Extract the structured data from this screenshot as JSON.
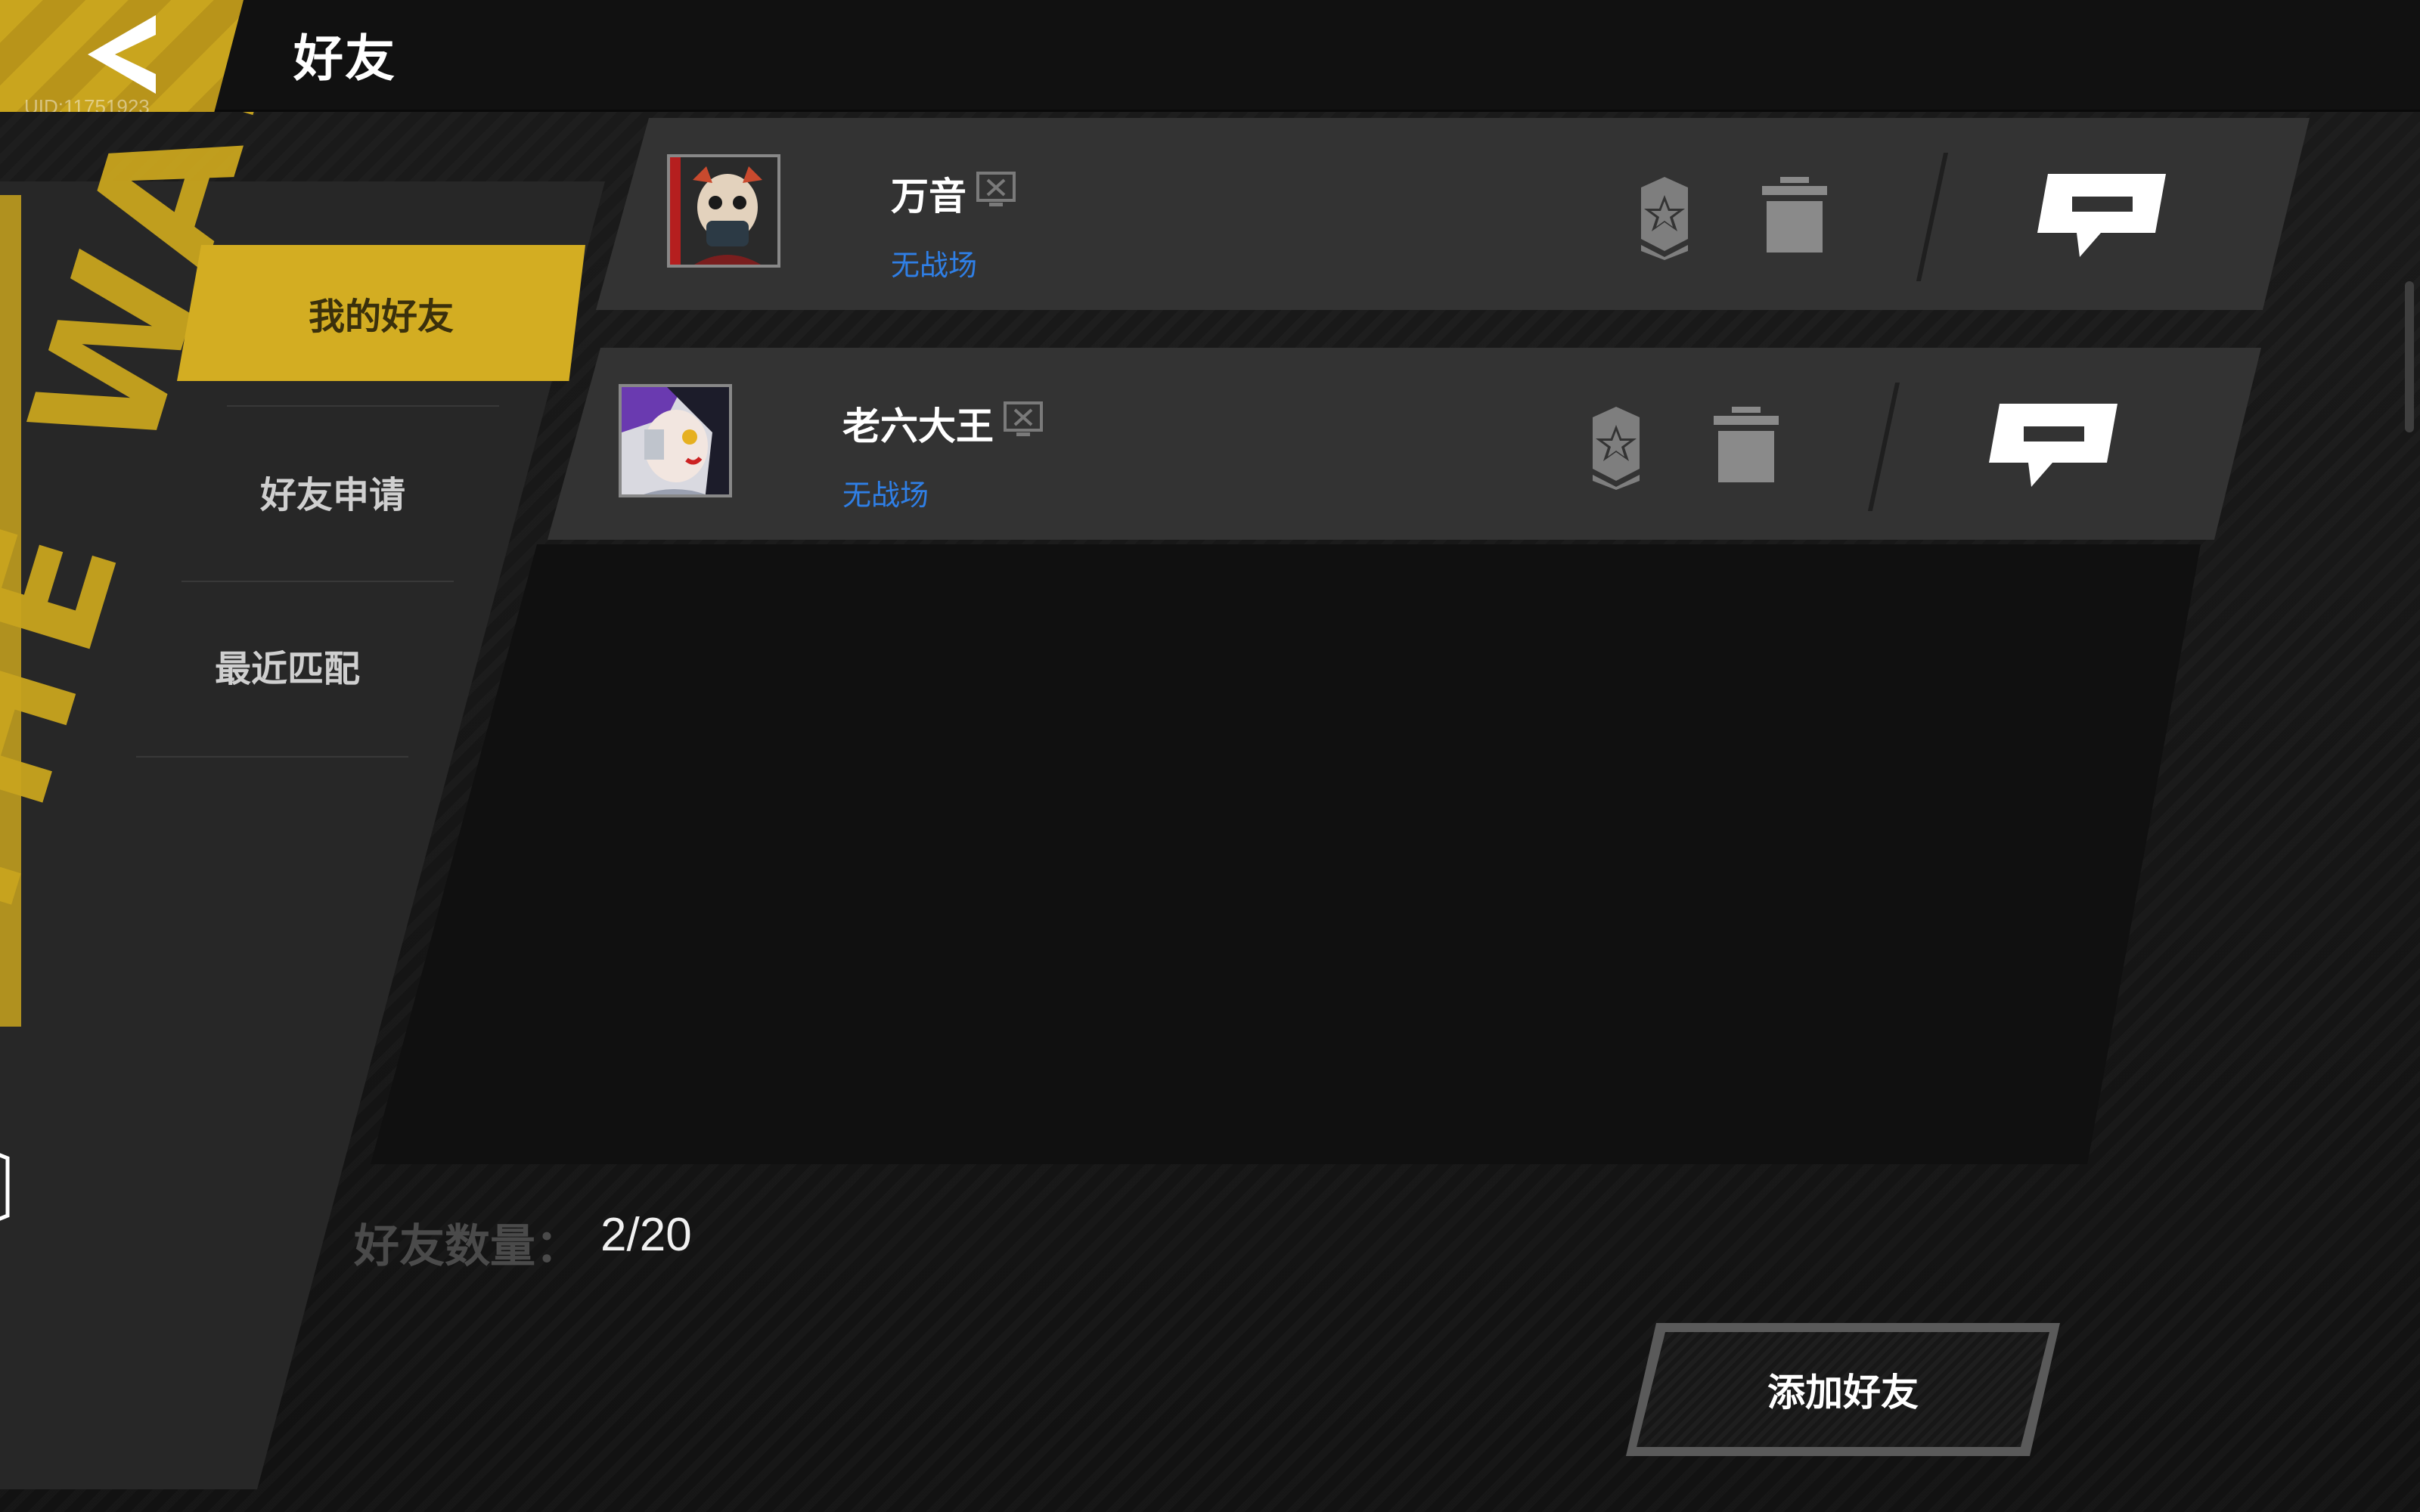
{
  "header": {
    "title": "好友",
    "uid": "UID:11751923"
  },
  "sidebar": {
    "decor_text": "THE WAR",
    "items": [
      {
        "label": "我的好友",
        "active": true
      },
      {
        "label": "好友申请",
        "active": false
      },
      {
        "label": "最近匹配",
        "active": false
      }
    ]
  },
  "friends": [
    {
      "name": "万音",
      "status": "无战场"
    },
    {
      "name": "老六大王",
      "status": "无战场"
    }
  ],
  "footer": {
    "count_label": "好友数量：",
    "count_value": "2/20",
    "add_button": "添加好友"
  },
  "colors": {
    "accent_yellow": "#d3ad22",
    "status_blue": "#2f7fe6",
    "row_bg": "#333333"
  },
  "icons": {
    "back": "chevron-left-icon",
    "offline": "offline-monitor-icon",
    "badge": "star-badge-icon",
    "delete": "trash-icon",
    "chat": "chat-bubble-icon"
  }
}
